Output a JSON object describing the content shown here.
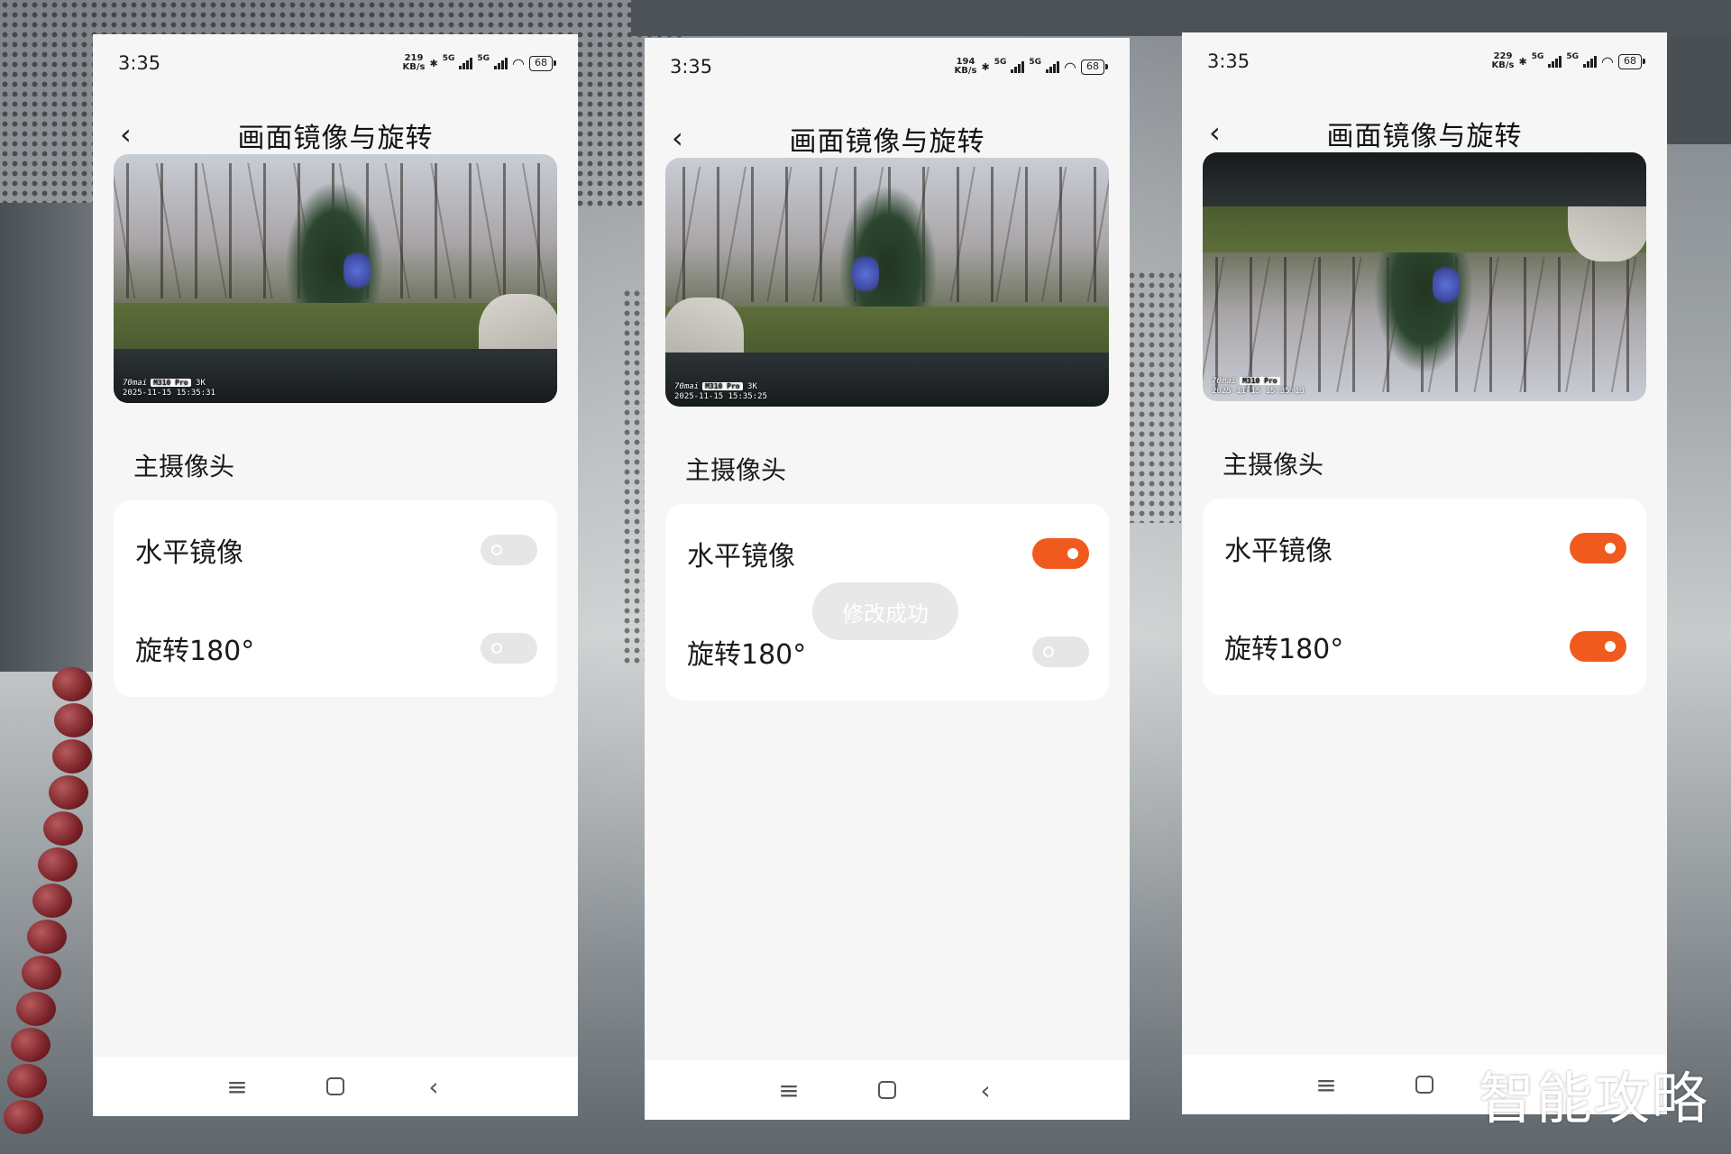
{
  "watermark": "智能攻略",
  "colors": {
    "accent": "#f15a1e",
    "toggle_off": "#e6e6e6",
    "background": "#f6f6f6"
  },
  "screens": [
    {
      "time": "3:35",
      "net_speed_value": "219",
      "net_speed_unit": "KB/s",
      "signal_1": "5G",
      "signal_2": "5G",
      "battery": "68",
      "title": "画面镜像与旋转",
      "preview": {
        "brand": "70mai",
        "model": "M310 Pro",
        "res": "3K",
        "timestamp": "2025-11-15  15:35:31"
      },
      "section": "主摄像头",
      "settings": [
        {
          "label": "水平镜像",
          "on": false
        },
        {
          "label": "旋转180°",
          "on": false
        }
      ]
    },
    {
      "time": "3:35",
      "net_speed_value": "194",
      "net_speed_unit": "KB/s",
      "signal_1": "5G",
      "signal_2": "5G",
      "battery": "68",
      "title": "画面镜像与旋转",
      "preview": {
        "brand": "70mai",
        "model": "M310 Pro",
        "res": "3K",
        "timestamp": "2025-11-15  15:35:25"
      },
      "section": "主摄像头",
      "settings": [
        {
          "label": "水平镜像",
          "on": true
        },
        {
          "label": "旋转180°",
          "on": false
        }
      ],
      "toast": "修改成功"
    },
    {
      "time": "3:35",
      "net_speed_value": "229",
      "net_speed_unit": "KB/s",
      "signal_1": "5G",
      "signal_2": "5G",
      "battery": "68",
      "title": "画面镜像与旋转",
      "preview": {
        "brand": "70mai",
        "model": "M310 Pro",
        "res": "",
        "timestamp": "2025-11-15  15:35:13"
      },
      "section": "主摄像头",
      "settings": [
        {
          "label": "水平镜像",
          "on": true
        },
        {
          "label": "旋转180°",
          "on": true
        }
      ]
    }
  ]
}
